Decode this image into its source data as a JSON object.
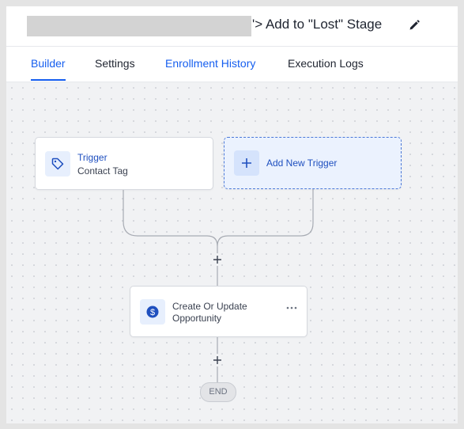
{
  "header": {
    "title": "'> Add to \"Lost\" Stage",
    "edit_icon": "pencil-icon"
  },
  "tabs": [
    {
      "label": "Builder",
      "active": true
    },
    {
      "label": "Settings",
      "active": false
    },
    {
      "label": "Enrollment History",
      "active": false
    },
    {
      "label": "Execution Logs",
      "active": false
    }
  ],
  "canvas": {
    "trigger": {
      "title": "Trigger",
      "subtitle": "Contact Tag",
      "icon": "tag-icon"
    },
    "add_trigger": {
      "label": "Add New Trigger",
      "icon": "plus-icon"
    },
    "action": {
      "label": "Create Or Update Opportunity",
      "icon": "dollar-icon"
    },
    "end": {
      "label": "END"
    }
  },
  "colors": {
    "accent": "#155eef",
    "add_trigger_bg": "#ebf2fe",
    "canvas_bg": "#f1f2f4"
  }
}
